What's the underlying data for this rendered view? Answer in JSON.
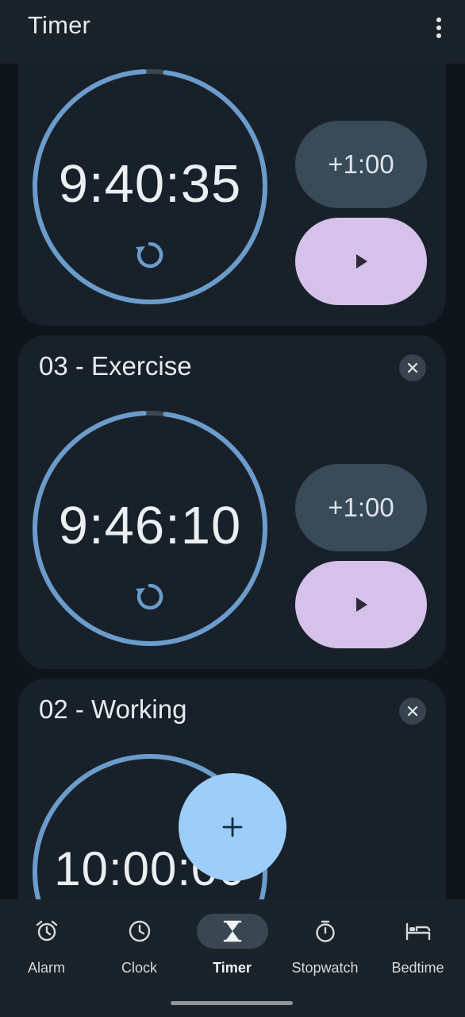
{
  "app_bar": {
    "title": "Timer"
  },
  "timers": [
    {
      "label": "",
      "time": "9:40:35",
      "add_label": "+1:00",
      "progress": 0.97
    },
    {
      "label": "03 - Exercise",
      "time": "9:46:10",
      "add_label": "+1:00",
      "progress": 0.97
    },
    {
      "label": "02 - Working",
      "time": "10:00:00",
      "add_label": "",
      "progress": 1.0
    }
  ],
  "fab": {
    "icon": "plus-icon"
  },
  "bottom_nav": {
    "items": [
      {
        "label": "Alarm",
        "icon": "alarm-icon"
      },
      {
        "label": "Clock",
        "icon": "clock-icon"
      },
      {
        "label": "Timer",
        "icon": "hourglass-icon",
        "active": true
      },
      {
        "label": "Stopwatch",
        "icon": "stopwatch-icon"
      },
      {
        "label": "Bedtime",
        "icon": "bed-icon"
      }
    ]
  },
  "colors": {
    "background": "#0f151b",
    "card": "#18212a",
    "ring": "#6b9ccb",
    "play_button": "#d6c1ea",
    "add_button": "#394a58",
    "fab": "#9dcdf9"
  }
}
